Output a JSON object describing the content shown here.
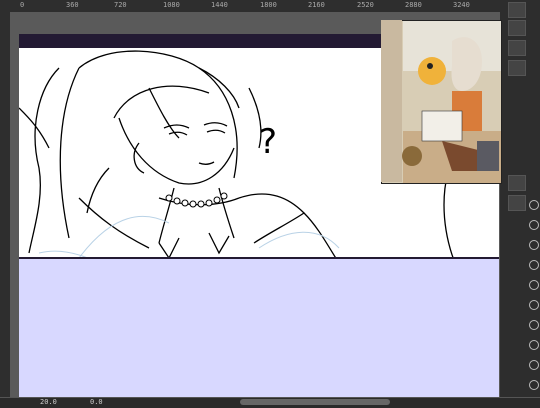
{
  "ruler": {
    "labels": [
      "0",
      "360",
      "720",
      "1080",
      "1440",
      "1800",
      "2160",
      "2520",
      "2880",
      "3240"
    ]
  },
  "annotation": {
    "question_mark": "?"
  },
  "status": {
    "zoom": "20.0",
    "angle": "0.0"
  },
  "navigator": {
    "title": ""
  }
}
